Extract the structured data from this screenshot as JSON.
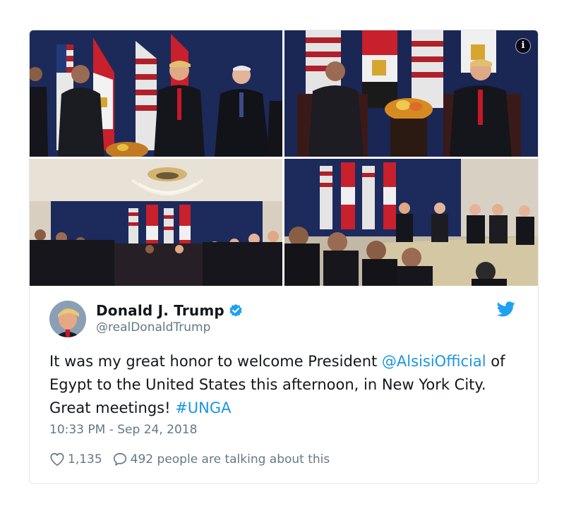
{
  "tweet": {
    "display_name": "Donald J. Trump",
    "handle": "@realDonaldTrump",
    "text_before": "It was my great honor to welcome President ",
    "mention": "@AlsisiOfficial",
    "text_middle": " of Egypt to the United States this afternoon, in New York City. Great meetings! ",
    "hashtag": "#UNGA",
    "timestamp": "10:33 PM - Sep 24, 2018",
    "likes": "1,135",
    "talking": "492 people are talking about this"
  },
  "media": {
    "info_label": "i",
    "photo_count": 4
  },
  "icons": {
    "verified": "verified-badge-icon",
    "bird": "twitter-bird-icon",
    "like": "heart-icon",
    "reply": "speech-bubble-icon",
    "info": "info-icon"
  },
  "colors": {
    "link": "#1b95e0",
    "muted": "#657786",
    "text": "#14171a",
    "brand": "#1da1f2"
  }
}
